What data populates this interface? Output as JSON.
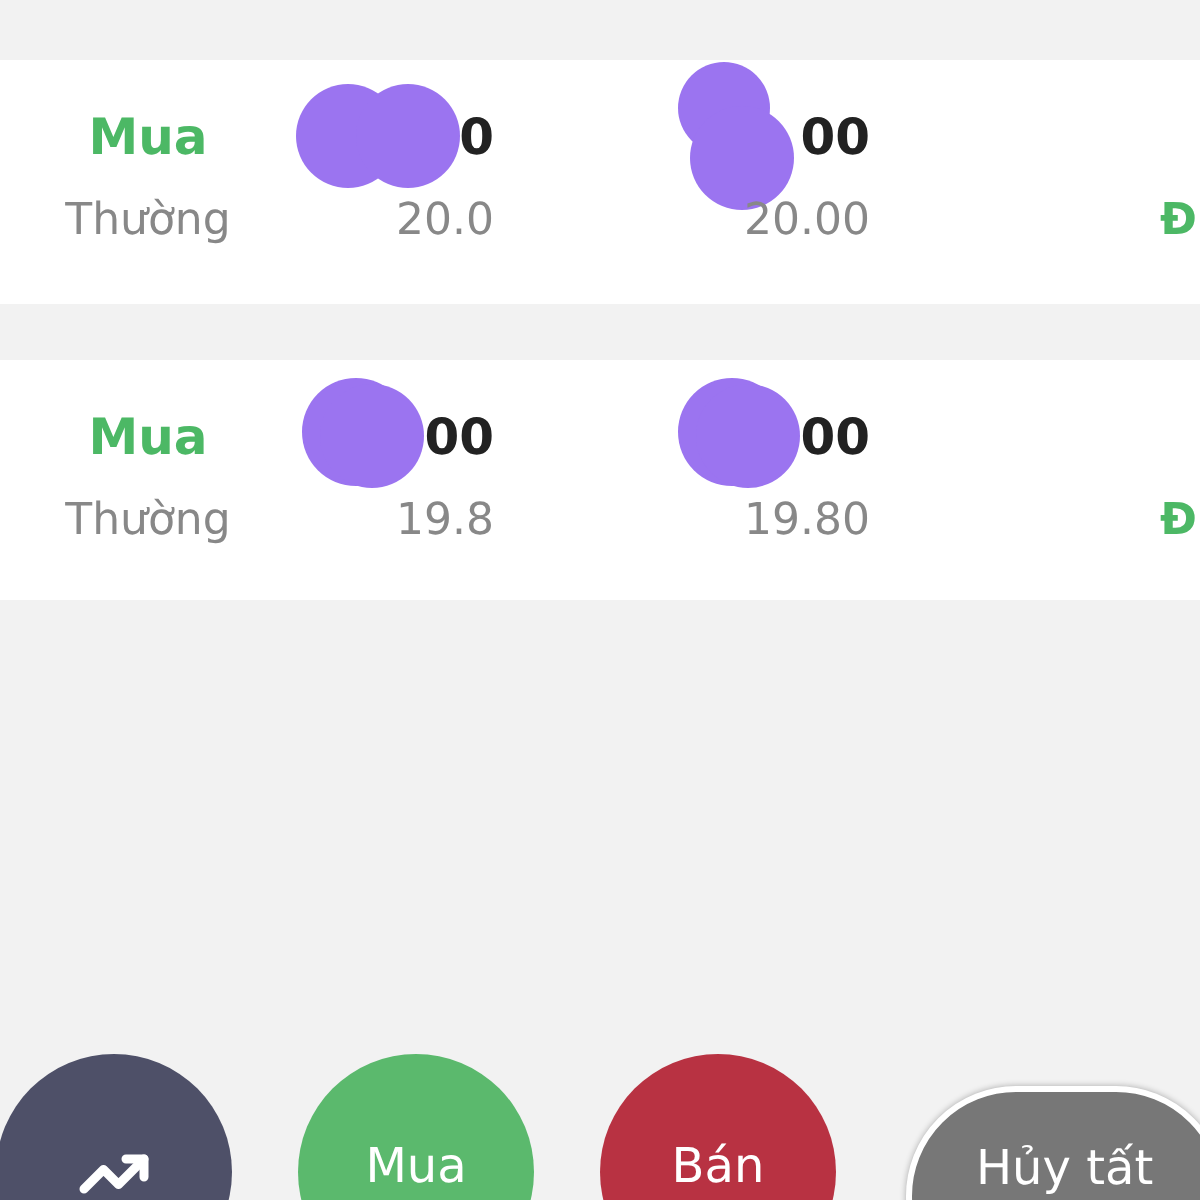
{
  "orders": [
    {
      "side": "Mua",
      "type": "Thường",
      "quantity": "0",
      "price": "00",
      "price_small": "20.0",
      "value": "20.00",
      "status": "Đ",
      "redactions": [
        {
          "kind": "double"
        },
        {
          "kind": "stacked"
        }
      ]
    },
    {
      "side": "Mua",
      "type": "Thường",
      "quantity": "00",
      "price": "00",
      "price_small": "19.8",
      "value": "19.80",
      "status": "Đ",
      "redactions": [
        {
          "kind": "single"
        },
        {
          "kind": "single"
        }
      ]
    }
  ],
  "actions": [
    {
      "kind": "icon"
    },
    {
      "kind": "buy",
      "label": "Mua"
    },
    {
      "kind": "sell",
      "label": "Bán"
    },
    {
      "kind": "cancel",
      "label": "Hủy tất"
    }
  ]
}
